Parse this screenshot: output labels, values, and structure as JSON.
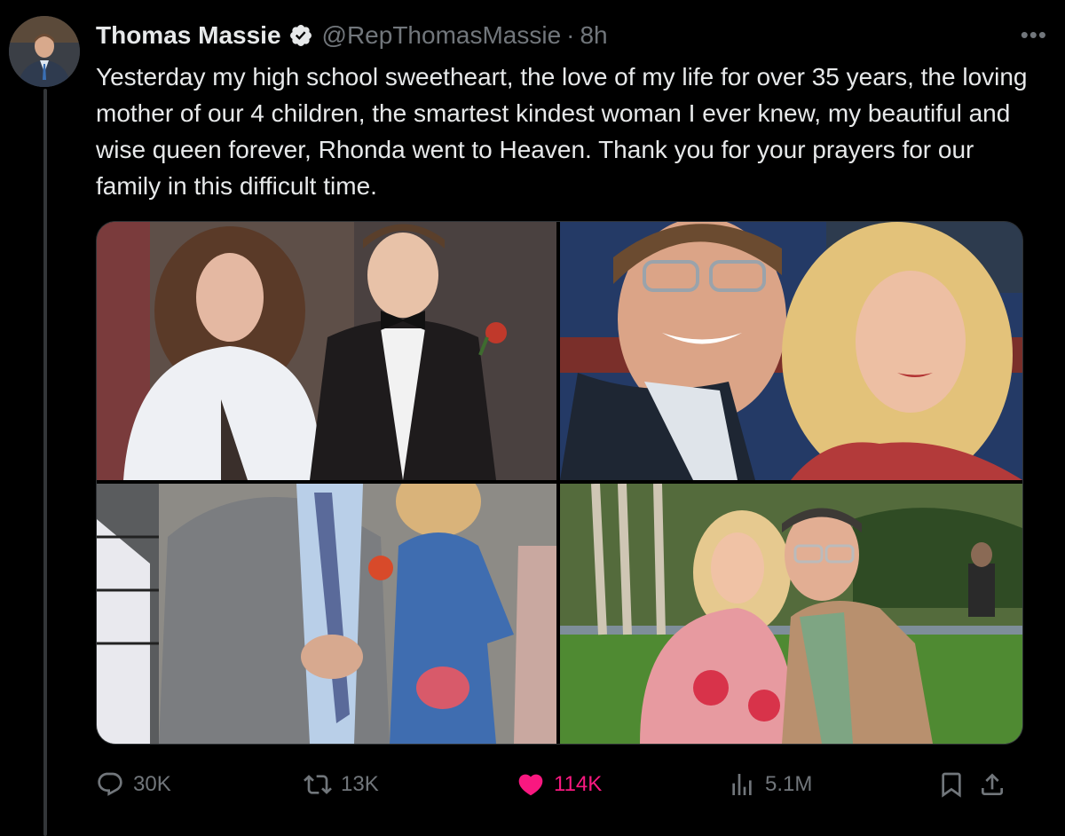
{
  "tweet": {
    "author_name": "Thomas Massie",
    "handle": "@RepThomasMassie",
    "separator": "·",
    "time": "8h",
    "more_icon": "more-horizontal-icon",
    "verified_icon": "verified-badge-icon",
    "text": "Yesterday my high school sweetheart, the love of my life for over 35 years, the loving mother of our 4 children, the smartest kindest woman I ever knew, my beautiful and wise queen forever, Rhonda went to Heaven. Thank you for your prayers for our family in this difficult time."
  },
  "actions": {
    "replies": "30K",
    "reposts": "13K",
    "likes": "114K",
    "views": "5.1M",
    "reply_icon": "reply-bubble-icon",
    "repost_icon": "repost-icon",
    "like_icon": "heart-filled-icon",
    "views_icon": "views-bar-icon",
    "bookmark_icon": "bookmark-icon",
    "share_icon": "share-icon",
    "like_color": "#f91880"
  },
  "colors": {
    "background": "#000000",
    "text_primary": "#e7e9ea",
    "text_secondary": "#71767b",
    "verified": "#e7e9ea"
  }
}
